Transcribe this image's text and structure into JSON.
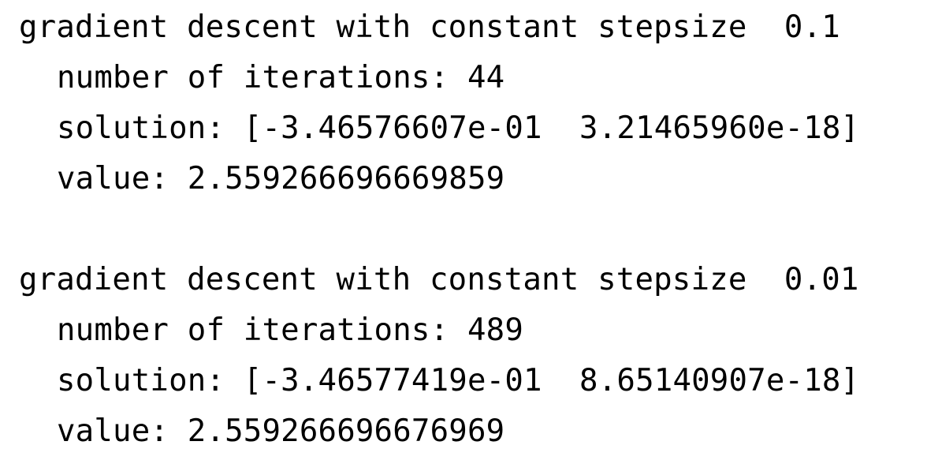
{
  "output": {
    "runs": [
      {
        "header": "gradient descent with constant stepsize  0.1",
        "iterations": "number of iterations: 44",
        "solution": "solution: [-3.46576607e-01  3.21465960e-18]",
        "value": "value: 2.559266696669859"
      },
      {
        "header": "gradient descent with constant stepsize  0.01",
        "iterations": "number of iterations: 489",
        "solution": "solution: [-3.46577419e-01  8.65140907e-18]",
        "value": "value: 2.559266696676969"
      }
    ]
  }
}
